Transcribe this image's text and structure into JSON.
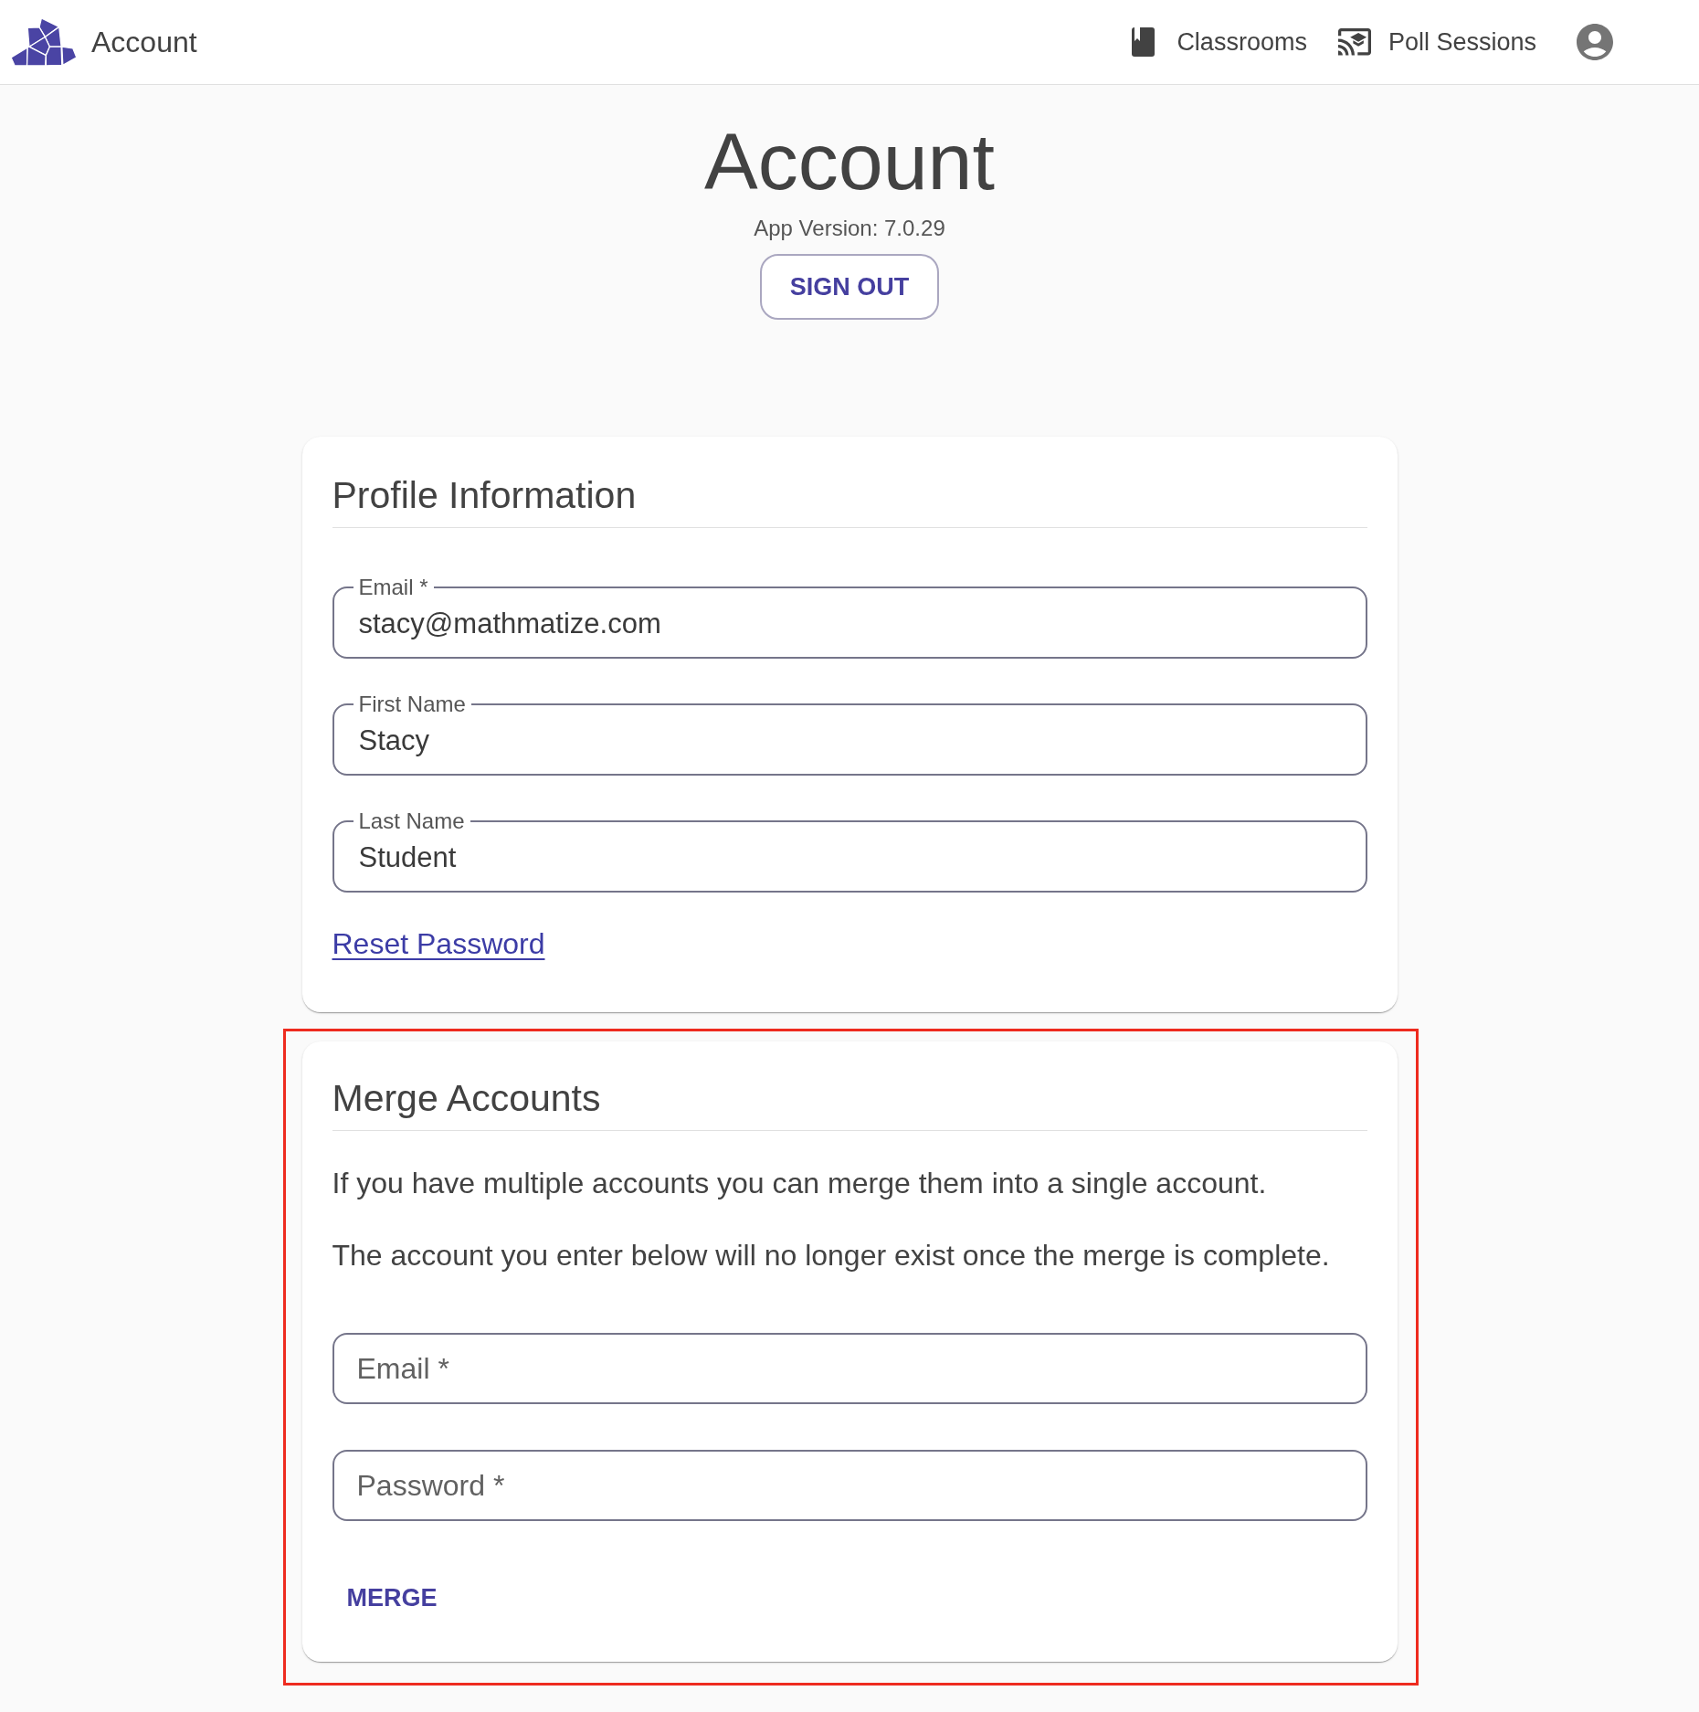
{
  "header": {
    "title": "Account",
    "nav": [
      {
        "label": "Classrooms"
      },
      {
        "label": "Poll Sessions"
      }
    ]
  },
  "page": {
    "title": "Account",
    "version": "App Version: 7.0.29",
    "sign_out_button": "SIGN OUT"
  },
  "profile_card": {
    "title": "Profile Information",
    "fields": [
      {
        "label": "Email *",
        "value": "stacy@mathmatize.com"
      },
      {
        "label": "First Name",
        "value": "Stacy"
      },
      {
        "label": "Last Name",
        "value": "Student"
      }
    ],
    "reset_password_link": "Reset Password"
  },
  "merge_card": {
    "highlighted": true,
    "title": "Merge Accounts",
    "paragraphs": [
      "If you have multiple accounts you can merge them into a single account.",
      "The account you enter below will no longer exist once the merge is complete."
    ],
    "fields": [
      {
        "placeholder": "Email *"
      },
      {
        "placeholder": "Password *"
      }
    ],
    "merge_button": "MERGE"
  }
}
